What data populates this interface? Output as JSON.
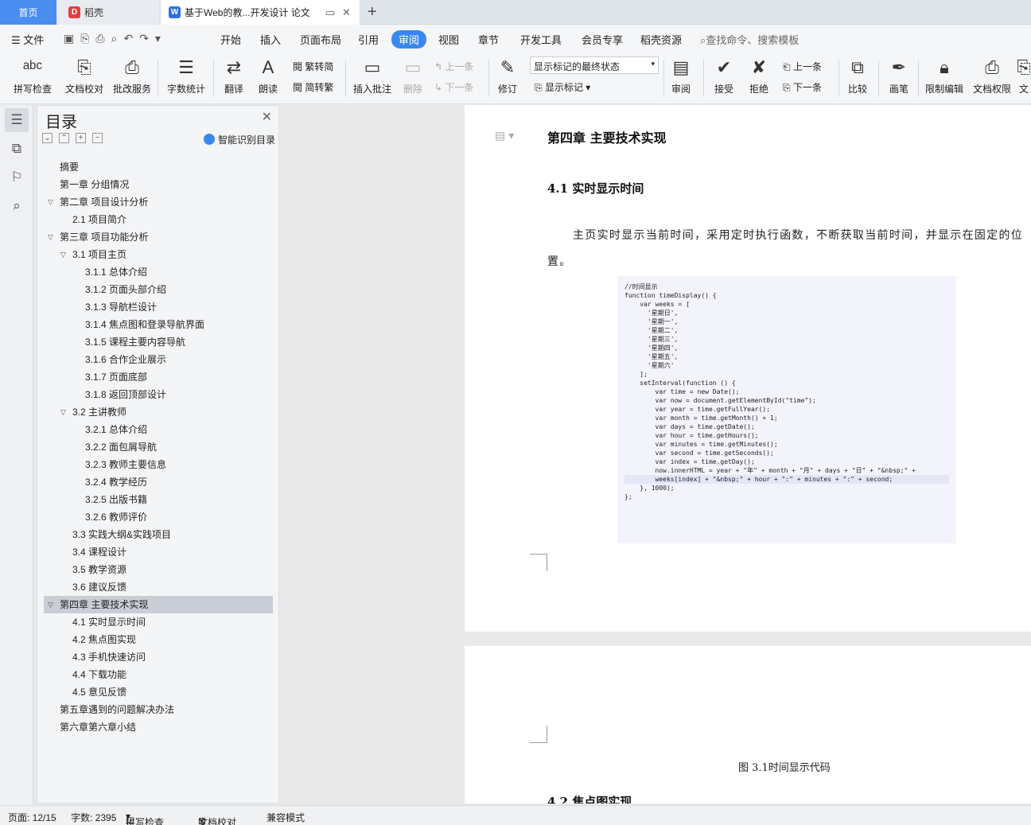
{
  "tabs": {
    "home": "首页",
    "daoke": "稻壳",
    "doc": "基于Web的教...开发设计 论文"
  },
  "menu": {
    "file": "文件",
    "items": [
      "开始",
      "插入",
      "页面布局",
      "引用",
      "审阅",
      "视图",
      "章节",
      "开发工具",
      "会员专享",
      "稻壳资源"
    ],
    "active": "审阅",
    "search": "查找命令、搜索模板"
  },
  "ribbon": {
    "spell": "拼写检查",
    "proofread": "文档校对",
    "batch": "批改服务",
    "wordcount": "字数统计",
    "translate": "翻译",
    "read": "朗读",
    "trad": "繁转简",
    "simp": "简转繁",
    "insert_comment": "插入批注",
    "delete": "删除",
    "prev_comment": "上一条",
    "next_comment": "下一条",
    "revise": "修订",
    "display_select": "显示标记的最终状态",
    "show_markup": "显示标记",
    "review": "审阅",
    "accept": "接受",
    "reject": "拒绝",
    "prev": "上一条",
    "next": "下一条",
    "compare": "比较",
    "pen": "画笔",
    "restrict": "限制编辑",
    "permission": "文档权限",
    "more": "文"
  },
  "toc": {
    "title": "目录",
    "smart": "智能识别目录",
    "items": [
      {
        "label": "摘要",
        "level": 0,
        "arrow": false
      },
      {
        "label": "第一章  分组情况",
        "level": 0,
        "arrow": false
      },
      {
        "label": "第二章  项目设计分析",
        "level": 0,
        "arrow": true
      },
      {
        "label": "2.1 项目简介",
        "level": 1,
        "arrow": false
      },
      {
        "label": "第三章  项目功能分析",
        "level": 0,
        "arrow": true
      },
      {
        "label": "3.1 项目主页",
        "level": 1,
        "arrow": true
      },
      {
        "label": "3.1.1 总体介绍",
        "level": 2,
        "arrow": false
      },
      {
        "label": "3.1.2 页面头部介绍",
        "level": 2,
        "arrow": false
      },
      {
        "label": "3.1.3 导航栏设计",
        "level": 2,
        "arrow": false
      },
      {
        "label": "3.1.4 焦点图和登录导航界面",
        "level": 2,
        "arrow": false
      },
      {
        "label": "3.1.5 课程主要内容导航",
        "level": 2,
        "arrow": false
      },
      {
        "label": "3.1.6 合作企业展示",
        "level": 2,
        "arrow": false
      },
      {
        "label": "3.1.7 页面底部",
        "level": 2,
        "arrow": false
      },
      {
        "label": "3.1.8 返回顶部设计",
        "level": 2,
        "arrow": false
      },
      {
        "label": "3.2 主讲教师",
        "level": 1,
        "arrow": true
      },
      {
        "label": "3.2.1 总体介绍",
        "level": 2,
        "arrow": false
      },
      {
        "label": "3.2.2 面包屑导航",
        "level": 2,
        "arrow": false
      },
      {
        "label": "3.2.3 教师主要信息",
        "level": 2,
        "arrow": false
      },
      {
        "label": "3.2.4 教学经历",
        "level": 2,
        "arrow": false
      },
      {
        "label": "3.2.5 出版书籍",
        "level": 2,
        "arrow": false
      },
      {
        "label": "3.2.6 教师评价",
        "level": 2,
        "arrow": false
      },
      {
        "label": "3.3 实践大纲&实践项目",
        "level": 1,
        "arrow": false
      },
      {
        "label": "3.4 课程设计",
        "level": 1,
        "arrow": false
      },
      {
        "label": "3.5 教学资源",
        "level": 1,
        "arrow": false
      },
      {
        "label": "3.6 建议反馈",
        "level": 1,
        "arrow": false
      },
      {
        "label": "第四章  主要技术实现",
        "level": 0,
        "arrow": true,
        "selected": true
      },
      {
        "label": "4.1 实时显示时间",
        "level": 1,
        "arrow": false
      },
      {
        "label": "4.2 焦点图实现",
        "level": 1,
        "arrow": false
      },
      {
        "label": "4.3 手机快速访问",
        "level": 1,
        "arrow": false
      },
      {
        "label": "4.4 下载功能",
        "level": 1,
        "arrow": false
      },
      {
        "label": "4.5 意见反馈",
        "level": 1,
        "arrow": false
      },
      {
        "label": "第五章遇到的问题解决办法",
        "level": 0,
        "arrow": false
      },
      {
        "label": "第六章第六章小结",
        "level": 0,
        "arrow": false
      }
    ]
  },
  "doc": {
    "chapter": "第四章  主要技术实现",
    "section": "4.1 实时显示时间",
    "paragraph": "主页实时显示当前时间，采用定时执行函数，不断获取当前时间，并显示在固定的位置。",
    "code_lines": [
      "//时间显示",
      "function timeDisplay() {",
      "    var weeks = [",
      "      '星期日',",
      "      '星期一',",
      "      '星期二',",
      "      '星期三',",
      "      '星期四',",
      "      '星期五',",
      "      '星期六'",
      "    ];",
      "    setInterval(function () {",
      "        var time = new Date();",
      "        var now = document.getElementById(\"time\");",
      "",
      "        var year = time.getFullYear();",
      "        var month = time.getMonth() + 1;",
      "        var days = time.getDate();",
      "        var hour = time.getHours();",
      "        var minutes = time.getMinutes();",
      "        var second = time.getSeconds();",
      "",
      "        var index = time.getDay();",
      "",
      "        now.innerHTML = year + \"年\" + month + \"月\" + days + \"日\" + \"&nbsp;\" +",
      "        weeks[index] + \"&nbsp;\" + hour + \":\" + minutes + \":\" + second;",
      "",
      "    }, 1000);",
      "};"
    ],
    "caption": "图 3.1时间显示代码",
    "next_section": "4.2 焦点图实现"
  },
  "status": {
    "page": "页面: 12/15",
    "words": "字数: 2395",
    "spell": "拼写检查",
    "proof": "文档校对",
    "mode": "兼容模式"
  }
}
